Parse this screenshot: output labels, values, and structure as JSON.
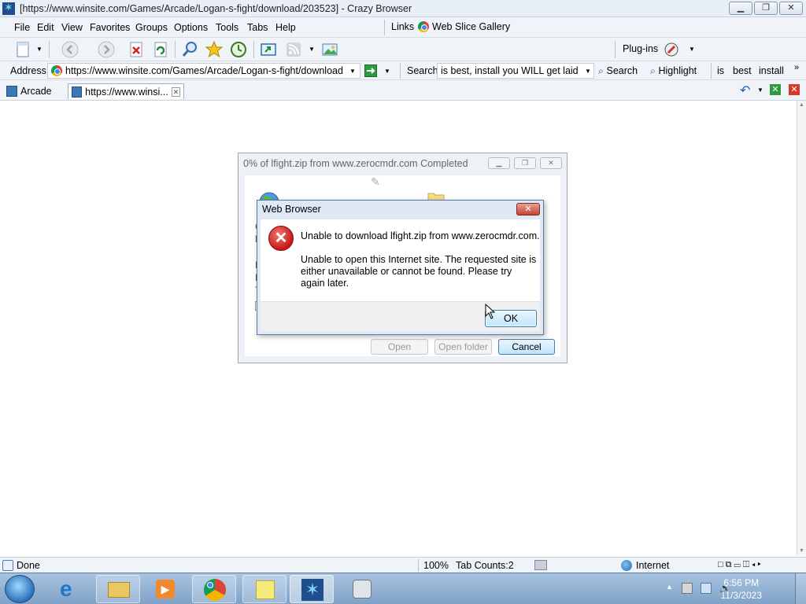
{
  "window": {
    "title": "[https://www.winsite.com/Games/Arcade/Logan-s-fight/download/203523] - Crazy Browser"
  },
  "menu": {
    "items": [
      "File",
      "Edit",
      "View",
      "Favorites",
      "Groups",
      "Options",
      "Tools",
      "Tabs",
      "Help"
    ],
    "links_label": "Links",
    "web_slice": "Web Slice Gallery"
  },
  "toolbar": {
    "plugins_label": "Plug-ins"
  },
  "address": {
    "label": "Address",
    "url": "https://www.winsite.com/Games/Arcade/Logan-s-fight/download"
  },
  "search": {
    "label": "Search",
    "value": "is best, install you WILL get laid",
    "button": "Search",
    "highlight": "Highlight",
    "keywords": [
      "is",
      "best",
      "install"
    ]
  },
  "tabs": [
    {
      "label": "Arcade"
    },
    {
      "label": "https://www.winsi..."
    }
  ],
  "download_dialog": {
    "title": "0% of lfight.zip from www.zerocmdr.com Completed",
    "text_fragments": [
      "Ge",
      "lfi",
      "Es",
      "Do",
      "Tr"
    ],
    "open_button": "Open",
    "open_folder_button": "Open folder",
    "cancel_button": "Cancel"
  },
  "error_dialog": {
    "title": "Web Browser",
    "message_line1": "Unable to download lfight.zip from www.zerocmdr.com.",
    "message_line2": "Unable to open this Internet site.  The requested site is either unavailable or cannot be found.  Please try again later.",
    "ok_button": "OK"
  },
  "status": {
    "text": "Done",
    "zoom": "100%",
    "tab_counts": "Tab Counts:2",
    "zone": "Internet"
  },
  "taskbar": {
    "time": "6:56 PM",
    "date": "11/3/2023"
  },
  "colors": {
    "accent": "#3c7fb1",
    "error_red": "#c5171a",
    "taskbar": "#8fb0d3"
  }
}
